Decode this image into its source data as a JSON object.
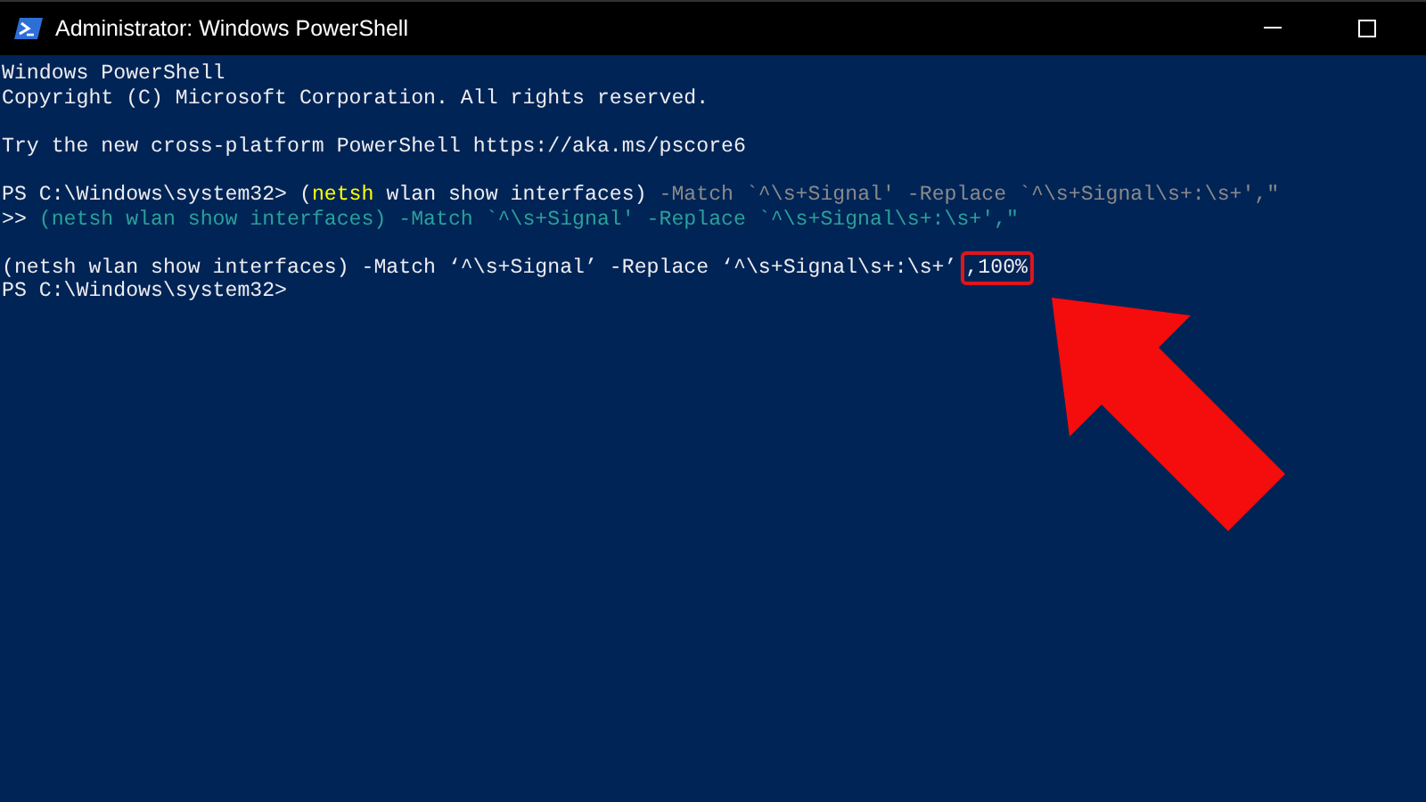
{
  "window": {
    "title": "Administrator: Windows PowerShell"
  },
  "console": {
    "lines": [
      {
        "segments": [
          {
            "kind": "output",
            "text": "Windows PowerShell"
          }
        ]
      },
      {
        "segments": [
          {
            "kind": "output",
            "text": "Copyright (C) Microsoft Corporation. All rights reserved."
          }
        ]
      },
      {
        "kind": "blank"
      },
      {
        "segments": [
          {
            "kind": "output",
            "text": "Try the new cross-platform PowerShell https://aka.ms/pscore6"
          }
        ]
      },
      {
        "kind": "blank"
      },
      {
        "segments": [
          {
            "kind": "output",
            "text": "PS C:\\Windows\\system32> ("
          },
          {
            "kind": "command",
            "text": "netsh"
          },
          {
            "kind": "output",
            "text": " wlan show interfaces) "
          },
          {
            "kind": "parameter",
            "text": "-Match `^\\s+Signal' -Replace `^\\s+Signal\\s+:\\s+',\""
          }
        ]
      },
      {
        "segments": [
          {
            "kind": "output",
            "text": ">> "
          },
          {
            "kind": "string",
            "text": "(netsh wlan show interfaces) -Match `^\\s+Signal' -Replace `^\\s+Signal\\s+:\\s+',\""
          }
        ]
      },
      {
        "kind": "blank"
      },
      {
        "segments": [
          {
            "kind": "output",
            "text": "(netsh wlan show interfaces) -Match ‘^\\s+Signal’ -Replace ‘^\\s+Signal\\s+:\\s+’"
          },
          {
            "kind": "output",
            "text": ",100%",
            "highlighted": true
          }
        ]
      },
      {
        "segments": [
          {
            "kind": "output",
            "text": "PS C:\\Windows\\system32>"
          }
        ]
      }
    ]
  }
}
